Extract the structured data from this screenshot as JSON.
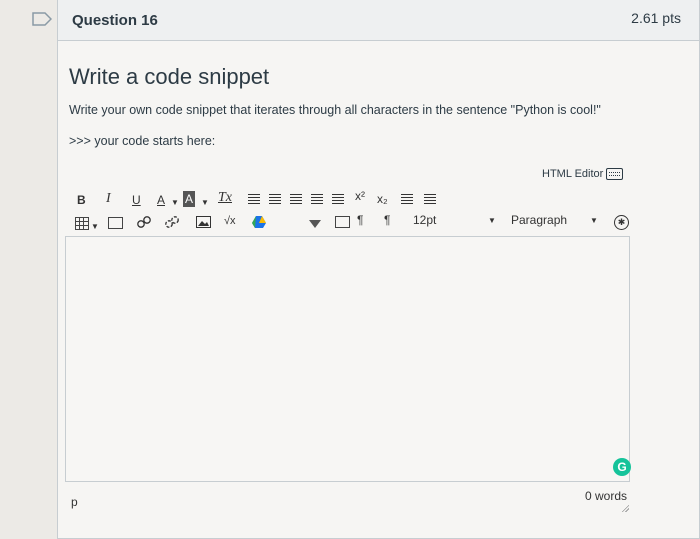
{
  "question": {
    "title": "Question 16",
    "points": "2.61 pts",
    "heading": "Write a code snippet",
    "prompt": "Write your own code snippet that iterates through all characters in the sentence \"Python is cool!\"",
    "start_text": ">>> your code starts here:"
  },
  "editor": {
    "html_editor_link": "HTML Editor",
    "toolbar": {
      "bold": "B",
      "italic": "I",
      "underline": "U",
      "text_color": "A",
      "bg_color": "A",
      "clear_format": "Tx",
      "superscript": "x²",
      "subscript": "x₂",
      "ltr": "¶",
      "rtl": "¶",
      "font_size": "12pt",
      "paragraph": "Paragraph",
      "equation": "√x"
    },
    "content": "",
    "path": "p",
    "word_count": "0 words",
    "grammarly": "G"
  },
  "icons": [
    "flag-icon",
    "bold-icon",
    "italic-icon",
    "underline-icon",
    "text-color-icon",
    "background-color-icon",
    "clear-formatting-icon",
    "align-left-icon",
    "align-center-icon",
    "align-right-icon",
    "indent-icon",
    "outdent-icon",
    "superscript-icon",
    "subscript-icon",
    "bullet-list-icon",
    "numbered-list-icon",
    "table-icon",
    "embed-icon",
    "link-icon",
    "unlink-icon",
    "image-icon",
    "equation-icon",
    "drive-icon",
    "dropdown-icon",
    "media-icon",
    "ltr-icon",
    "rtl-icon",
    "accessibility-icon",
    "keyboard-icon",
    "grammarly-icon",
    "resize-handle-icon"
  ]
}
